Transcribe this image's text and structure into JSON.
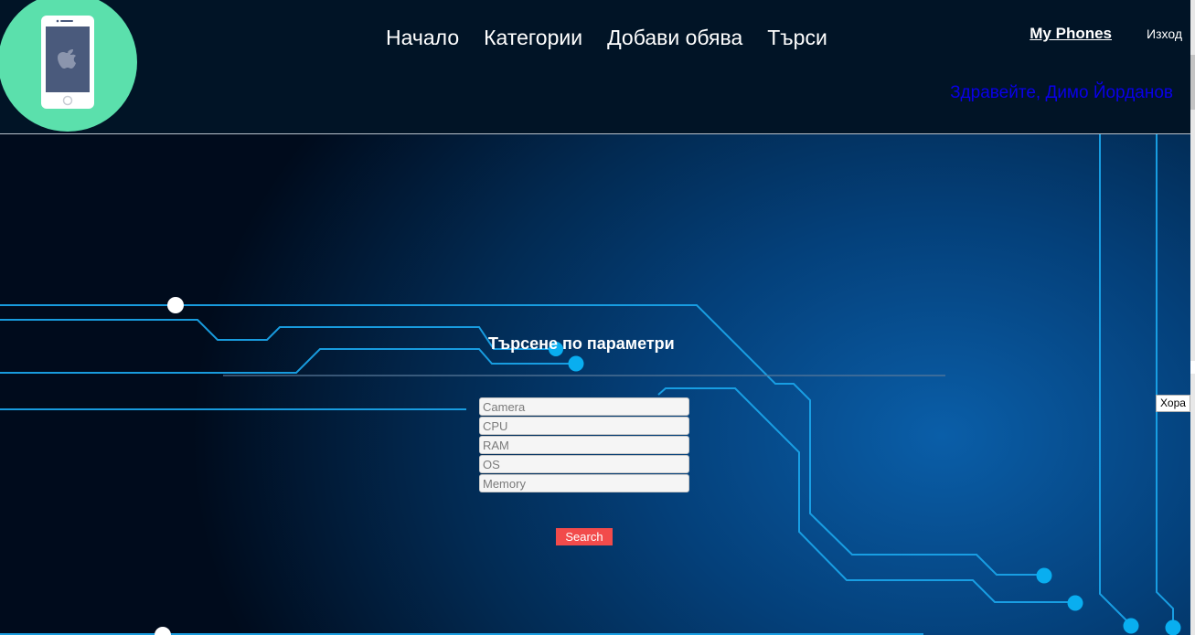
{
  "header": {
    "logo_icon": "smartphone-icon",
    "nav": [
      {
        "label": "Начало"
      },
      {
        "label": "Категории"
      },
      {
        "label": "Добави обява"
      },
      {
        "label": "Търси"
      }
    ],
    "my_phones": "My Phones",
    "logout": "Изход",
    "greeting": "Здравейте, Димо Йорданов"
  },
  "search": {
    "title": "Търсене по параметри",
    "fields": [
      {
        "placeholder": "Camera",
        "value": ""
      },
      {
        "placeholder": "CPU",
        "value": ""
      },
      {
        "placeholder": "RAM",
        "value": ""
      },
      {
        "placeholder": "OS",
        "value": ""
      },
      {
        "placeholder": "Memory",
        "value": ""
      }
    ],
    "button": "Search"
  },
  "side": {
    "tab_label": "Хора"
  },
  "colors": {
    "header_bg": "#011426",
    "logo_bg": "#5be0ac",
    "greeting": "#0a00e8",
    "search_button": "#f24b4b",
    "circuit_line": "#1aa3e8",
    "circuit_node": "#09aef0"
  }
}
